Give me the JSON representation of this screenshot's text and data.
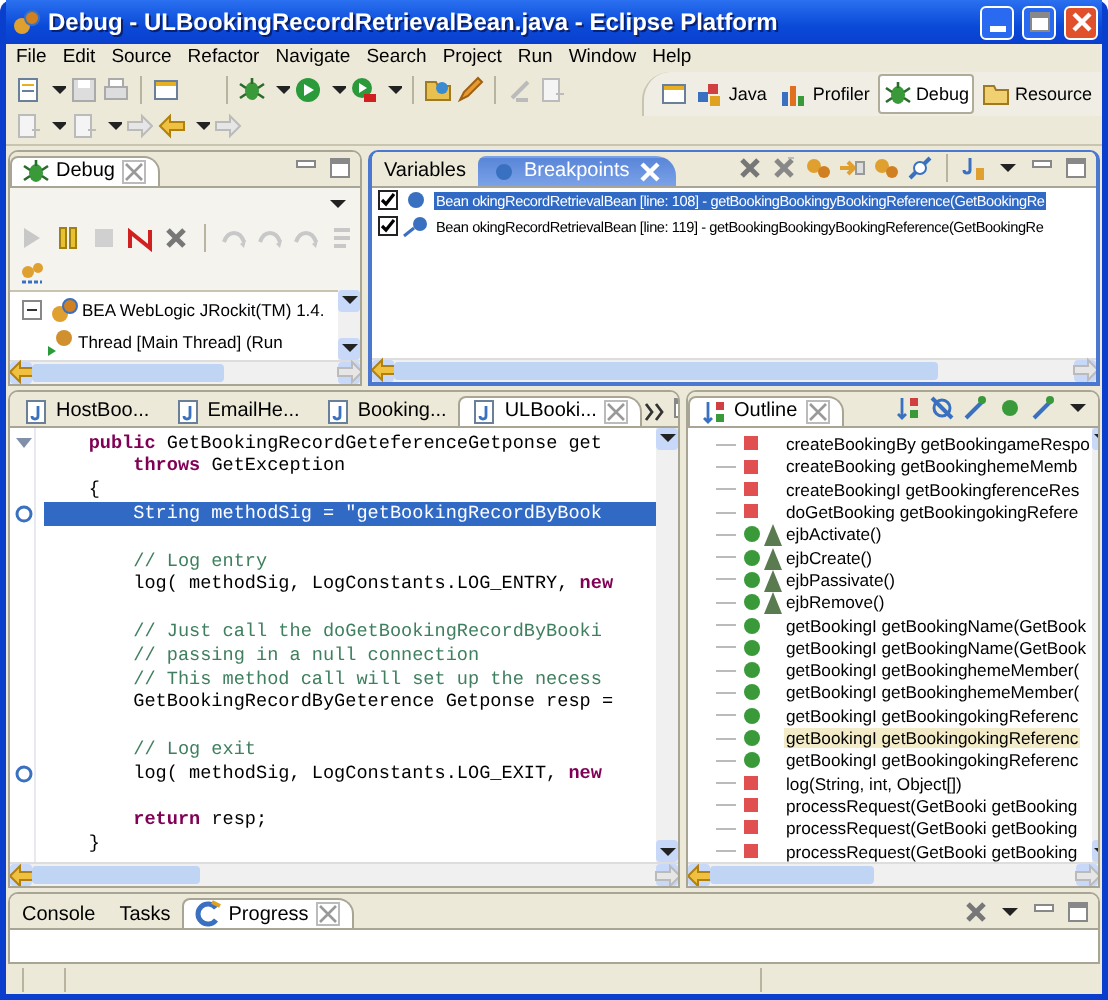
{
  "window": {
    "title": "Debug - ULBookingRecordRetrievalBean.java - Eclipse Platform"
  },
  "menu": [
    "File",
    "Edit",
    "Source",
    "Refactor",
    "Navigate",
    "Search",
    "Project",
    "Run",
    "Window",
    "Help"
  ],
  "perspectives": [
    {
      "label": "Java",
      "selected": false
    },
    {
      "label": "Profiler",
      "selected": false
    },
    {
      "label": "Debug",
      "selected": true
    },
    {
      "label": "Resource",
      "selected": false
    }
  ],
  "debug_view": {
    "title": "Debug",
    "tree": [
      {
        "label": "BEA WebLogic JRockit(TM) 1.4.",
        "expanded": true,
        "children": [
          {
            "label": "Thread [Main Thread] (Run"
          }
        ]
      }
    ]
  },
  "breakpoints_view": {
    "tabs": [
      {
        "label": "Variables",
        "selected": false
      },
      {
        "label": "Breakpoints",
        "selected": true
      }
    ],
    "rows": [
      {
        "label": "Bean okingRecordRetrievalBean [line: 108] - getBookingBookingyBookingReference(GetBookingRe",
        "checked": true,
        "selected": true
      },
      {
        "label": "Bean okingRecordRetrievalBean [line: 119] - getBookingBookingyBookingReference(GetBookingRe",
        "checked": true,
        "selected": false
      }
    ]
  },
  "editor": {
    "tabs": [
      {
        "label": "HostBoo...",
        "selected": false
      },
      {
        "label": "EmailHe...",
        "selected": false
      },
      {
        "label": "Booking...",
        "selected": false
      },
      {
        "label": "ULBooki...",
        "selected": true
      }
    ],
    "lines": [
      {
        "kind": "code",
        "collapsible": true,
        "breakpoint": false,
        "selected": false,
        "segments": [
          {
            "kind": "keyword",
            "text": "    public"
          },
          {
            "kind": "plain",
            "text": " GetBookingRecordGeteferenceGetponse get"
          }
        ]
      },
      {
        "kind": "code",
        "collapsible": false,
        "breakpoint": false,
        "selected": false,
        "segments": [
          {
            "kind": "keyword",
            "text": "        throws"
          },
          {
            "kind": "plain",
            "text": " GetException"
          }
        ]
      },
      {
        "kind": "code",
        "collapsible": false,
        "breakpoint": false,
        "selected": false,
        "segments": [
          {
            "kind": "plain",
            "text": "    {"
          }
        ]
      },
      {
        "kind": "code",
        "collapsible": false,
        "breakpoint": true,
        "selected": true,
        "segments": [
          {
            "kind": "plain",
            "text": "        String methodSig = "
          },
          {
            "kind": "string",
            "text": "\"getBookingRecordByBook"
          }
        ]
      },
      {
        "kind": "blank"
      },
      {
        "kind": "code",
        "collapsible": false,
        "breakpoint": false,
        "selected": false,
        "segments": [
          {
            "kind": "comment",
            "text": "        // Log entry"
          }
        ]
      },
      {
        "kind": "code",
        "collapsible": false,
        "breakpoint": false,
        "selected": false,
        "segments": [
          {
            "kind": "plain",
            "text": "        log( methodSig, LogConstants.LOG_ENTRY, "
          },
          {
            "kind": "keyword",
            "text": "new"
          }
        ]
      },
      {
        "kind": "blank"
      },
      {
        "kind": "code",
        "collapsible": false,
        "breakpoint": false,
        "selected": false,
        "segments": [
          {
            "kind": "comment",
            "text": "        // Just call the doGetBookingRecordByBooki"
          }
        ]
      },
      {
        "kind": "code",
        "collapsible": false,
        "breakpoint": false,
        "selected": false,
        "segments": [
          {
            "kind": "comment",
            "text": "        // passing in a null connection"
          }
        ]
      },
      {
        "kind": "code",
        "collapsible": false,
        "breakpoint": false,
        "selected": false,
        "segments": [
          {
            "kind": "comment",
            "text": "        // This method call will set up the necess"
          }
        ]
      },
      {
        "kind": "code",
        "collapsible": false,
        "breakpoint": false,
        "selected": false,
        "segments": [
          {
            "kind": "plain",
            "text": "        GetBookingRecordByGeterence Getponse resp ="
          }
        ]
      },
      {
        "kind": "blank"
      },
      {
        "kind": "code",
        "collapsible": false,
        "breakpoint": false,
        "selected": false,
        "segments": [
          {
            "kind": "comment",
            "text": "        // Log exit"
          }
        ]
      },
      {
        "kind": "code",
        "collapsible": false,
        "breakpoint": true,
        "selected": false,
        "segments": [
          {
            "kind": "plain",
            "text": "        log( methodSig, LogConstants.LOG_EXIT, "
          },
          {
            "kind": "keyword",
            "text": "new"
          }
        ]
      },
      {
        "kind": "blank"
      },
      {
        "kind": "code",
        "collapsible": false,
        "breakpoint": false,
        "selected": false,
        "segments": [
          {
            "kind": "keyword",
            "text": "        return"
          },
          {
            "kind": "plain",
            "text": " resp;"
          }
        ]
      },
      {
        "kind": "code",
        "collapsible": false,
        "breakpoint": false,
        "selected": false,
        "segments": [
          {
            "kind": "plain",
            "text": "    }"
          }
        ]
      }
    ]
  },
  "outline": {
    "title": "Outline",
    "items": [
      {
        "label": "createBookingBy getBookingameRespo",
        "kind": "private",
        "overrides": false,
        "selected": false
      },
      {
        "label": "createBooking getBookinghemeMemb",
        "kind": "private",
        "overrides": false,
        "selected": false
      },
      {
        "label": "createBookingI getBookingferenceRes",
        "kind": "private",
        "overrides": false,
        "selected": false
      },
      {
        "label": "doGetBooking getBookingokingRefere",
        "kind": "private",
        "overrides": false,
        "selected": false
      },
      {
        "label": "ejbActivate()",
        "kind": "public",
        "overrides": true,
        "selected": false
      },
      {
        "label": "ejbCreate()",
        "kind": "public",
        "overrides": true,
        "selected": false
      },
      {
        "label": "ejbPassivate()",
        "kind": "public",
        "overrides": true,
        "selected": false
      },
      {
        "label": "ejbRemove()",
        "kind": "public",
        "overrides": true,
        "selected": false
      },
      {
        "label": "getBookingI getBookingName(GetBook",
        "kind": "public",
        "overrides": false,
        "selected": false
      },
      {
        "label": "getBookingI getBookingName(GetBook",
        "kind": "public",
        "overrides": false,
        "selected": false
      },
      {
        "label": "getBookingI getBookinghemeMember(",
        "kind": "public",
        "overrides": false,
        "selected": false
      },
      {
        "label": "getBookingI getBookinghemeMember(",
        "kind": "public",
        "overrides": false,
        "selected": false
      },
      {
        "label": "getBookingI getBookingokingReferenc",
        "kind": "public",
        "overrides": false,
        "selected": false
      },
      {
        "label": "getBookingI getBookingokingReferenc",
        "kind": "public",
        "overrides": false,
        "selected": true
      },
      {
        "label": "getBookingI getBookingokingReferenc",
        "kind": "public",
        "overrides": false,
        "selected": false
      },
      {
        "label": "log(String, int, Object[])",
        "kind": "private",
        "overrides": false,
        "selected": false
      },
      {
        "label": "processRequest(GetBooki getBooking",
        "kind": "private",
        "overrides": false,
        "selected": false
      },
      {
        "label": "processRequest(GetBooki getBooking",
        "kind": "private",
        "overrides": false,
        "selected": false
      },
      {
        "label": "processRequest(GetBooki getBooking",
        "kind": "private",
        "overrides": false,
        "selected": false
      }
    ]
  },
  "bottom_view": {
    "tabs": [
      {
        "label": "Console",
        "selected": false
      },
      {
        "label": "Tasks",
        "selected": false
      },
      {
        "label": "Progress",
        "selected": true
      }
    ]
  }
}
